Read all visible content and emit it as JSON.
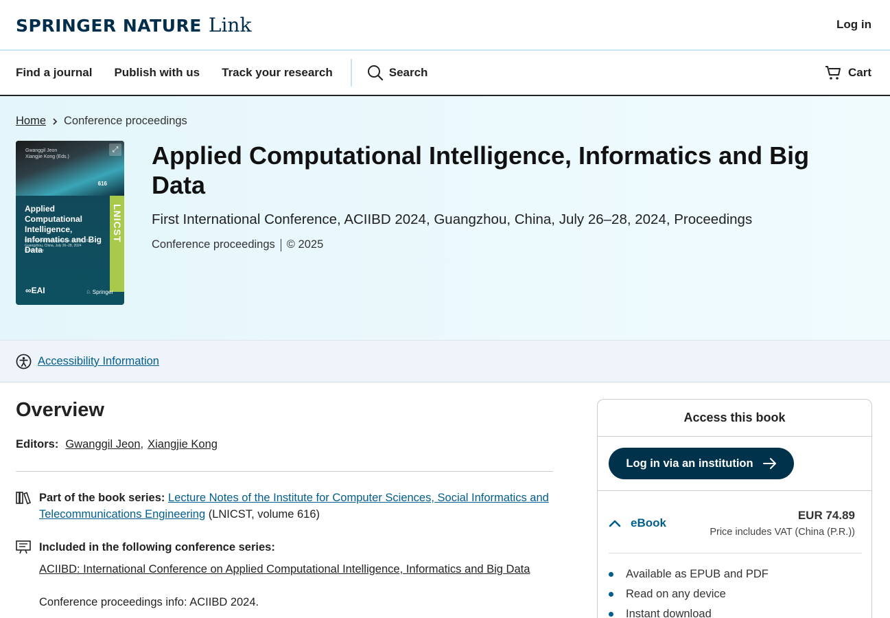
{
  "header": {
    "logo_main": "SPRINGER NATURE",
    "logo_link": "Link",
    "login": "Log in"
  },
  "nav": {
    "items": [
      "Find a journal",
      "Publish with us",
      "Track your research"
    ],
    "search": "Search",
    "cart": "Cart"
  },
  "breadcrumb": {
    "home": "Home",
    "current": "Conference proceedings"
  },
  "cover": {
    "editors_line1": "Gwanggil Jeon",
    "editors_line2": "Xiangjie Kong (Eds.)",
    "volume": "616",
    "series_abbr": "LNICST",
    "title": "Applied Computational Intelligence, Informatics and Big Data",
    "subtitle_line1": "First International Conference, ACIIBD 2024",
    "subtitle_line2": "Guangzhou, China, July 26–28, 2024",
    "subtitle_line3": "Proceedings",
    "publisher_left": "EAI",
    "publisher_right": "Springer"
  },
  "book": {
    "title": "Applied Computational Intelligence, Informatics and Big Data",
    "subtitle": "First International Conference, ACIIBD 2024, Guangzhou, China, July 26–28, 2024, Proceedings",
    "type": "Conference proceedings",
    "year": "© 2025"
  },
  "accessibility": {
    "link": "Accessibility Information"
  },
  "overview": {
    "title": "Overview",
    "editors_label": "Editors:",
    "editor1": "Gwanggil Jeon",
    "editor2": "Xiangjie Kong",
    "series_label": "Part of the book series:",
    "series_link": "Lecture Notes of the Institute for Computer Sciences, Social Informatics and Telecommunications Engineering",
    "series_suffix": " (LNICST, volume 616)",
    "conf_label": "Included in the following conference series:",
    "conf_link": "ACIIBD: International Conference on Applied Computational Intelligence, Informatics and Big Data",
    "conf_info": "Conference proceedings info: ACIIBD 2024."
  },
  "access": {
    "title": "Access this book",
    "institution_button": "Log in via an institution",
    "ebook_label": "eBook",
    "price": "EUR 74.89",
    "vat_note": "Price includes VAT (China (P.R.))",
    "features": [
      "Available as EPUB and PDF",
      "Read on any device",
      "Instant download"
    ]
  },
  "colors": {
    "brand_navy": "#01324b",
    "link_blue": "#025e8d",
    "hero_bg": "#e4f6fb"
  }
}
